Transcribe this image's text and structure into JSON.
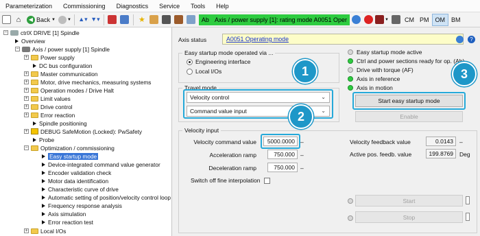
{
  "menu": [
    "Parameterization",
    "Commissioning",
    "Diagnostics",
    "Service",
    "Tools",
    "Help"
  ],
  "toolbar": {
    "back_label": "Back",
    "status_prefix": "Ab",
    "status_text": "Axis / power supply [1]:  rating mode   A0051 Oper",
    "modes": [
      "CM",
      "PM",
      "OM",
      "BM"
    ],
    "active_mode": "OM"
  },
  "tree": {
    "items": [
      "ctrlX DRIVE [1] Spindle",
      "Overview",
      "Axis / power supply [1] Spindle",
      "Power supply",
      "DC bus configuration",
      "Master communication",
      "Motor, drive mechanics, measuring systems",
      "Operation modes / Drive Halt",
      "Limit values",
      "Drive control",
      "Error reaction",
      "Spindle positioning",
      "DEBUG SafeMotion (Locked): PwSafety",
      "Probe",
      "Optimization / commissioning",
      "Easy startup mode",
      "Device-integrated command value generator",
      "Encoder validation check",
      "Motor data identification",
      "Characteristic curve of drive",
      "Automatic setting of position/velocity control loop",
      "Frequency response analysis",
      "Axis simulation",
      "Error reaction test",
      "Local I/Os"
    ]
  },
  "panel": {
    "axis_status_label": "Axis status",
    "axis_status_value": "A0051 Operating mode",
    "easy_group_title": "Easy startup mode operated via ...",
    "radio_engineering": "Engineering interface",
    "radio_local": "Local I/Os",
    "travel_group_title": "Travel mode",
    "combo_velocity": "Velocity control",
    "combo_command": "Command value input",
    "status_items": [
      "Easy startup mode active",
      "Ctrl and power sections ready for op. (Ab)",
      "Drive with torque (AF)",
      "Axis in reference",
      "Axis in motion"
    ],
    "start_button": "Start easy startup mode",
    "enable_button": "Enable",
    "velocity_group_title": "Velocity input",
    "vel_cmd_label": "Velocity command value",
    "vel_cmd_value": "5000.0000",
    "vel_cmd_unit": "–",
    "accel_label": "Acceleration ramp",
    "accel_value": "750.000",
    "accel_unit": "–",
    "decel_label": "Deceleration ramp",
    "decel_value": "750.000",
    "decel_unit": "–",
    "fine_interp_label": "Switch off fine interpolation",
    "vel_feedback_label": "Velocity feedback value",
    "vel_feedback_value": "0.0143",
    "vel_feedback_unit": "–",
    "pos_feedback_label": "Active pos. feedb. value",
    "pos_feedback_value": "199.8769",
    "pos_feedback_unit": "Deg",
    "start_label": "Start",
    "stop_label": "Stop",
    "badges": [
      "1",
      "2",
      "3"
    ]
  },
  "colors": {
    "highlight": "#25a9d9",
    "badge": "#1e97c8",
    "status_green": "#2ecc40",
    "link_blue": "#1a33cc",
    "selection": "#3875d7"
  }
}
